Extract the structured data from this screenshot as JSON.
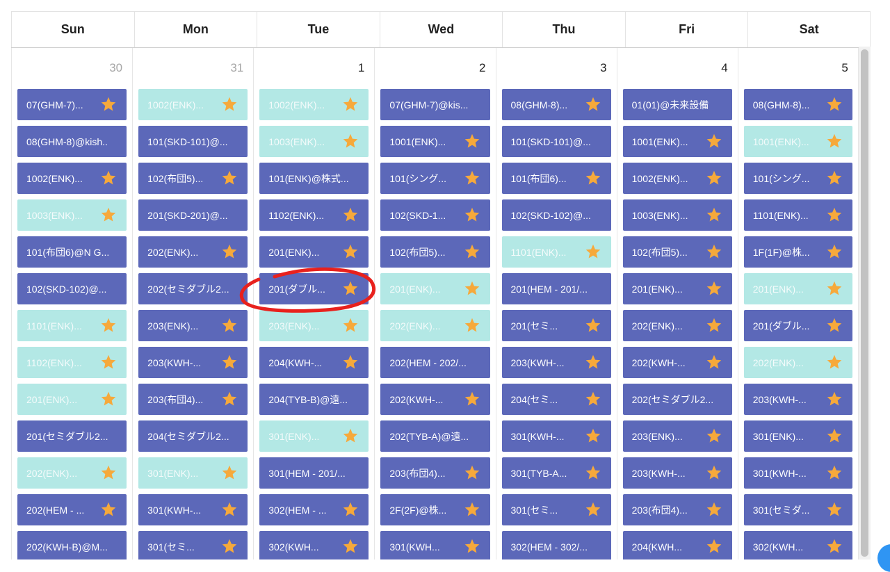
{
  "weekdays": [
    "Sun",
    "Mon",
    "Tue",
    "Wed",
    "Thu",
    "Fri",
    "Sat"
  ],
  "colors": {
    "type_a": "#5c68b9",
    "type_b": "#b3e8e5",
    "star": "#f6a93b",
    "annotation": "#e8211d"
  },
  "days": [
    {
      "number": "30",
      "muted": true,
      "events": [
        {
          "label": "07(GHM-7)...",
          "type": "a",
          "star": true
        },
        {
          "label": "08(GHM-8)@kish...",
          "type": "a",
          "star": false
        },
        {
          "label": "1002(ENK)...",
          "type": "a",
          "star": true
        },
        {
          "label": "1003(ENK)...",
          "type": "b",
          "star": true
        },
        {
          "label": "101(布団6)@N G...",
          "type": "a",
          "star": false
        },
        {
          "label": "102(SKD-102)@...",
          "type": "a",
          "star": false
        },
        {
          "label": "1101(ENK)...",
          "type": "b",
          "star": true
        },
        {
          "label": "1102(ENK)...",
          "type": "b",
          "star": true
        },
        {
          "label": "201(ENK)...",
          "type": "b",
          "star": true
        },
        {
          "label": "201(セミダブル2...",
          "type": "a",
          "star": false
        },
        {
          "label": "202(ENK)...",
          "type": "b",
          "star": true
        },
        {
          "label": "202(HEM - ...",
          "type": "a",
          "star": true
        },
        {
          "label": "202(KWH-B)@M...",
          "type": "a",
          "star": false
        }
      ]
    },
    {
      "number": "31",
      "muted": true,
      "events": [
        {
          "label": "1002(ENK)...",
          "type": "b",
          "star": true
        },
        {
          "label": "101(SKD-101)@...",
          "type": "a",
          "star": false
        },
        {
          "label": "102(布団5)...",
          "type": "a",
          "star": true
        },
        {
          "label": "201(SKD-201)@...",
          "type": "a",
          "star": false
        },
        {
          "label": "202(ENK)...",
          "type": "a",
          "star": true
        },
        {
          "label": "202(セミダブル2...",
          "type": "a",
          "star": false
        },
        {
          "label": "203(ENK)...",
          "type": "a",
          "star": true
        },
        {
          "label": "203(KWH-...",
          "type": "a",
          "star": true
        },
        {
          "label": "203(布団4)...",
          "type": "a",
          "star": true
        },
        {
          "label": "204(セミダブル2...",
          "type": "a",
          "star": false
        },
        {
          "label": "301(ENK)...",
          "type": "b",
          "star": true
        },
        {
          "label": "301(KWH-...",
          "type": "a",
          "star": true
        },
        {
          "label": "301(セミ...",
          "type": "a",
          "star": true
        }
      ]
    },
    {
      "number": "1",
      "muted": false,
      "events": [
        {
          "label": "1002(ENK)...",
          "type": "b",
          "star": true
        },
        {
          "label": "1003(ENK)...",
          "type": "b",
          "star": true
        },
        {
          "label": "101(ENK)@株式...",
          "type": "a",
          "star": false
        },
        {
          "label": "1102(ENK)...",
          "type": "a",
          "star": true
        },
        {
          "label": "201(ENK)...",
          "type": "a",
          "star": true
        },
        {
          "label": "201(ダブル...",
          "type": "a",
          "star": true
        },
        {
          "label": "203(ENK)...",
          "type": "b",
          "star": true
        },
        {
          "label": "204(KWH-...",
          "type": "a",
          "star": true
        },
        {
          "label": "204(TYB-B)@遠...",
          "type": "a",
          "star": false
        },
        {
          "label": "301(ENK)...",
          "type": "b",
          "star": true
        },
        {
          "label": "301(HEM - 201/...",
          "type": "a",
          "star": false
        },
        {
          "label": "302(HEM - ...",
          "type": "a",
          "star": true
        },
        {
          "label": "302(KWH...",
          "type": "a",
          "star": true
        }
      ]
    },
    {
      "number": "2",
      "muted": false,
      "events": [
        {
          "label": "07(GHM-7)@kis...",
          "type": "a",
          "star": false
        },
        {
          "label": "1001(ENK)...",
          "type": "a",
          "star": true
        },
        {
          "label": "101(シング...",
          "type": "a",
          "star": true
        },
        {
          "label": "102(SKD-1...",
          "type": "a",
          "star": true
        },
        {
          "label": "102(布団5)...",
          "type": "a",
          "star": true
        },
        {
          "label": "201(ENK)...",
          "type": "b",
          "star": true
        },
        {
          "label": "202(ENK)...",
          "type": "b",
          "star": true
        },
        {
          "label": "202(HEM - 202/...",
          "type": "a",
          "star": false
        },
        {
          "label": "202(KWH-...",
          "type": "a",
          "star": true
        },
        {
          "label": "202(TYB-A)@遠...",
          "type": "a",
          "star": false
        },
        {
          "label": "203(布団4)...",
          "type": "a",
          "star": true
        },
        {
          "label": "2F(2F)@株...",
          "type": "a",
          "star": true
        },
        {
          "label": "301(KWH...",
          "type": "a",
          "star": true
        }
      ]
    },
    {
      "number": "3",
      "muted": false,
      "events": [
        {
          "label": "08(GHM-8)...",
          "type": "a",
          "star": true
        },
        {
          "label": "101(SKD-101)@...",
          "type": "a",
          "star": false
        },
        {
          "label": "101(布団6)...",
          "type": "a",
          "star": true
        },
        {
          "label": "102(SKD-102)@...",
          "type": "a",
          "star": false
        },
        {
          "label": "1101(ENK)...",
          "type": "b",
          "star": true
        },
        {
          "label": "201(HEM - 201/...",
          "type": "a",
          "star": false
        },
        {
          "label": "201(セミ...",
          "type": "a",
          "star": true
        },
        {
          "label": "203(KWH-...",
          "type": "a",
          "star": true
        },
        {
          "label": "204(セミ...",
          "type": "a",
          "star": true
        },
        {
          "label": "301(KWH-...",
          "type": "a",
          "star": true
        },
        {
          "label": "301(TYB-A...",
          "type": "a",
          "star": true
        },
        {
          "label": "301(セミ...",
          "type": "a",
          "star": true
        },
        {
          "label": "302(HEM - 302/...",
          "type": "a",
          "star": false
        }
      ]
    },
    {
      "number": "4",
      "muted": false,
      "events": [
        {
          "label": "01(01)@未来設備",
          "type": "a",
          "star": false
        },
        {
          "label": "1001(ENK)...",
          "type": "a",
          "star": true
        },
        {
          "label": "1002(ENK)...",
          "type": "a",
          "star": true
        },
        {
          "label": "1003(ENK)...",
          "type": "a",
          "star": true
        },
        {
          "label": "102(布団5)...",
          "type": "a",
          "star": true
        },
        {
          "label": "201(ENK)...",
          "type": "a",
          "star": true
        },
        {
          "label": "202(ENK)...",
          "type": "a",
          "star": true
        },
        {
          "label": "202(KWH-...",
          "type": "a",
          "star": true
        },
        {
          "label": "202(セミダブル2...",
          "type": "a",
          "star": false
        },
        {
          "label": "203(ENK)...",
          "type": "a",
          "star": true
        },
        {
          "label": "203(KWH-...",
          "type": "a",
          "star": true
        },
        {
          "label": "203(布団4)...",
          "type": "a",
          "star": true
        },
        {
          "label": "204(KWH...",
          "type": "a",
          "star": true
        }
      ]
    },
    {
      "number": "5",
      "muted": false,
      "events": [
        {
          "label": "08(GHM-8)...",
          "type": "a",
          "star": true
        },
        {
          "label": "1001(ENK)...",
          "type": "b",
          "star": true
        },
        {
          "label": "101(シング...",
          "type": "a",
          "star": true
        },
        {
          "label": "1101(ENK)...",
          "type": "a",
          "star": true
        },
        {
          "label": "1F(1F)@株...",
          "type": "a",
          "star": true
        },
        {
          "label": "201(ENK)...",
          "type": "b",
          "star": true
        },
        {
          "label": "201(ダブル...",
          "type": "a",
          "star": true
        },
        {
          "label": "202(ENK)...",
          "type": "b",
          "star": true
        },
        {
          "label": "203(KWH-...",
          "type": "a",
          "star": true
        },
        {
          "label": "301(ENK)...",
          "type": "a",
          "star": true
        },
        {
          "label": "301(KWH-...",
          "type": "a",
          "star": true
        },
        {
          "label": "301(セミダ...",
          "type": "a",
          "star": true
        },
        {
          "label": "302(KWH...",
          "type": "a",
          "star": true
        }
      ]
    }
  ]
}
